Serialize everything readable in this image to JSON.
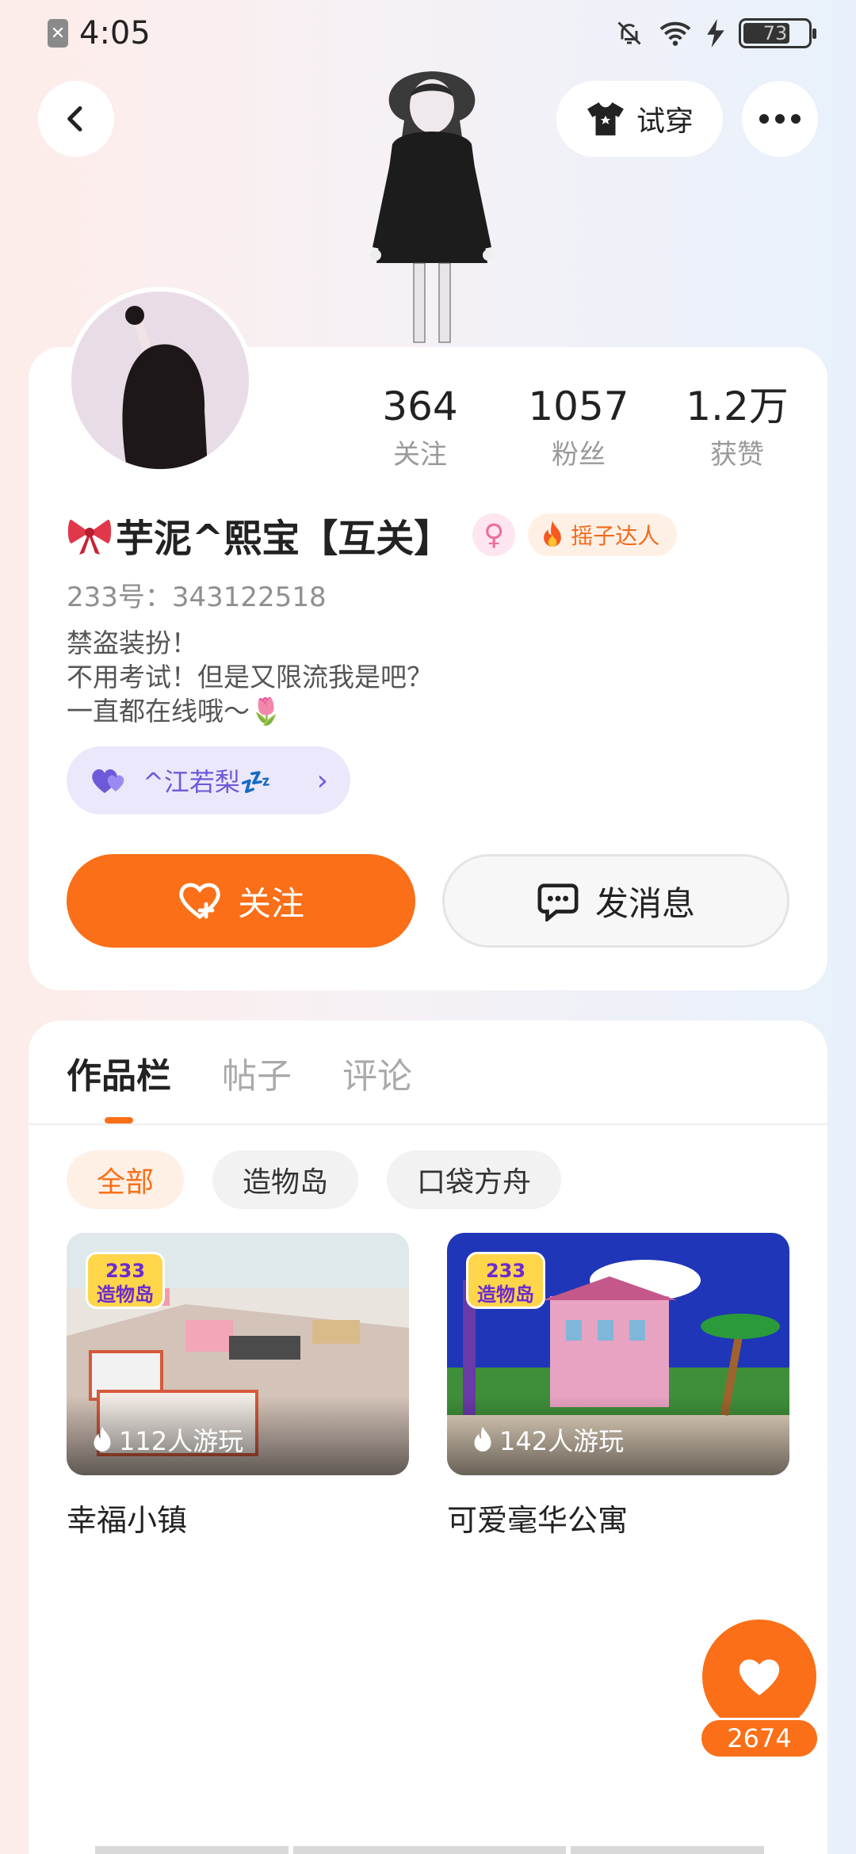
{
  "status_bar": {
    "time": "4:05",
    "battery": "73"
  },
  "header": {
    "tryon_label": "试穿"
  },
  "stats": [
    {
      "value": "364",
      "label": "关注"
    },
    {
      "value": "1057",
      "label": "粉丝"
    },
    {
      "value": "1.2万",
      "label": "获赞"
    }
  ],
  "profile": {
    "name": "芋泥^熙宝【互关】",
    "gender_symbol": "♀",
    "title_badge": "摇子达人",
    "uid": "233号：343122518",
    "bio": [
      "禁盗装扮！",
      "不用考试！但是又限流我是吧？",
      "一直都在线哦～🌷"
    ],
    "friend_name": "^江若梨💤"
  },
  "actions": {
    "follow": "关注",
    "message": "发消息"
  },
  "tabs": [
    "作品栏",
    "帖子",
    "评论"
  ],
  "filters": [
    "全部",
    "造物岛",
    "口袋方舟"
  ],
  "games": [
    {
      "title": "幸福小镇",
      "plays": "112人游玩",
      "logo_top": "233",
      "logo_bottom": "造物岛"
    },
    {
      "title": "可爱毫华公寓",
      "plays": "142人游玩",
      "logo_top": "233",
      "logo_bottom": "造物岛"
    }
  ],
  "fab": {
    "count": "2674"
  },
  "colors": {
    "accent": "#fa6f17",
    "friend_chip": "#ebe8fb",
    "gender": "#f06da0"
  }
}
